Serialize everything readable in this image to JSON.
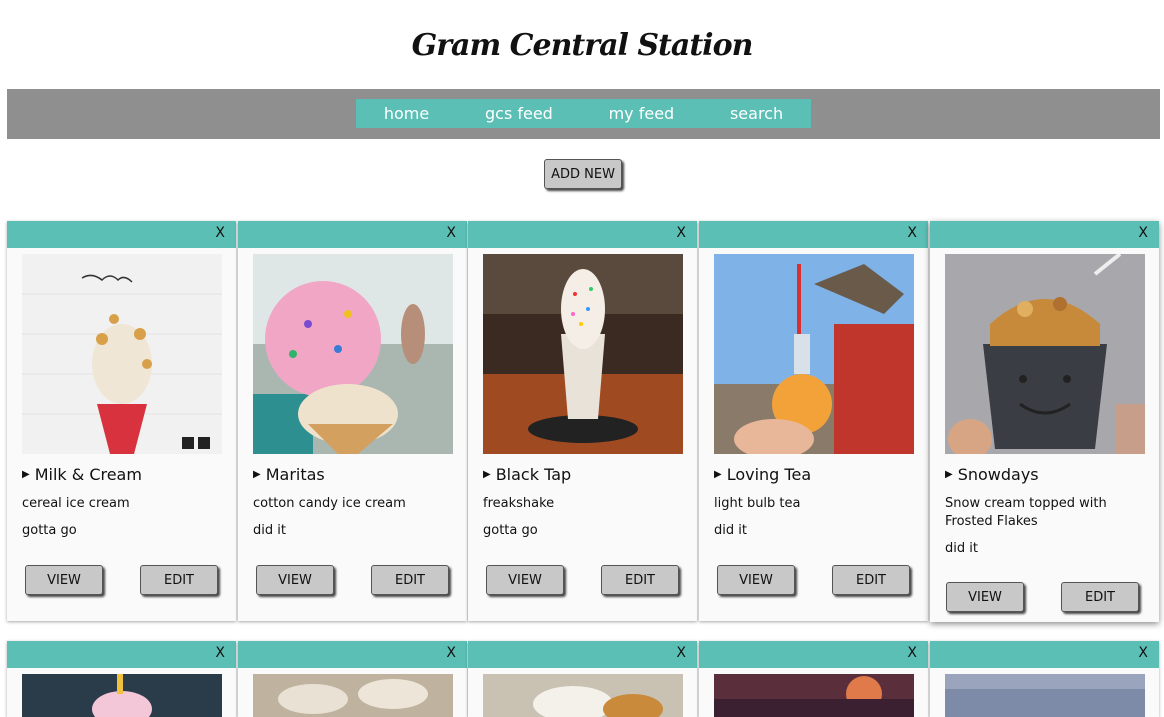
{
  "site": {
    "title": "Gram Central Station"
  },
  "nav": {
    "items": [
      "home",
      "gcs feed",
      "my feed",
      "search"
    ]
  },
  "add_button": "ADD NEW",
  "cards": [
    {
      "close": "X",
      "name": "Milk & Cream",
      "description": "cereal ice cream",
      "status": "gotta go",
      "view": "VIEW",
      "edit": "EDIT"
    },
    {
      "close": "X",
      "name": "Maritas",
      "description": "cotton candy ice cream",
      "status": "did it",
      "view": "VIEW",
      "edit": "EDIT"
    },
    {
      "close": "X",
      "name": "Black Tap",
      "description": "freakshake",
      "status": "gotta go",
      "view": "VIEW",
      "edit": "EDIT"
    },
    {
      "close": "X",
      "name": "Loving Tea",
      "description": "light bulb tea",
      "status": "did it",
      "view": "VIEW",
      "edit": "EDIT"
    },
    {
      "close": "X",
      "name": "Snowdays",
      "description": "Snow cream topped with Frosted Flakes",
      "status": "did it",
      "view": "VIEW",
      "edit": "EDIT"
    }
  ],
  "row2": [
    {
      "close": "X"
    },
    {
      "close": "X"
    },
    {
      "close": "X"
    },
    {
      "close": "X"
    },
    {
      "close": "X"
    }
  ]
}
